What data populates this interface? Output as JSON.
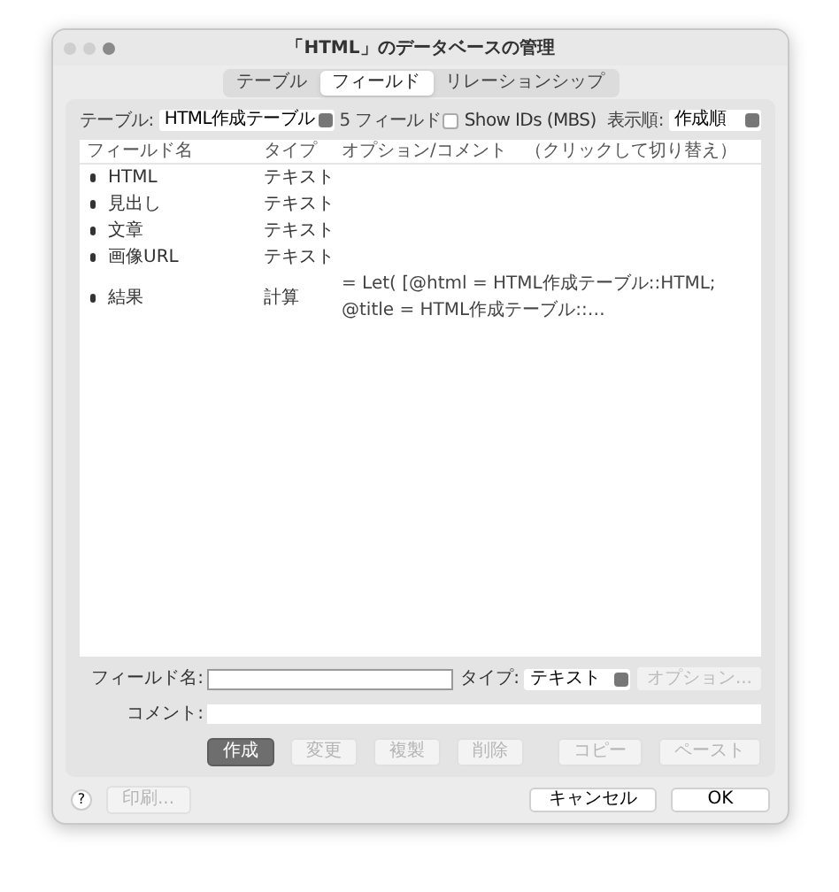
{
  "window": {
    "title": "「HTML」のデータベースの管理"
  },
  "tabs": [
    {
      "label": "テーブル",
      "selected": false
    },
    {
      "label": "フィールド",
      "selected": true
    },
    {
      "label": "リレーションシップ",
      "selected": false
    }
  ],
  "toolbar": {
    "table_label": "テーブル:",
    "table_value": "HTML作成テーブル",
    "field_count": "5 フィールド",
    "show_ids": {
      "label": "Show IDs (MBS)",
      "checked": false
    },
    "order_label": "表示順:",
    "order_value": "作成順"
  },
  "table": {
    "columns": [
      "フィールド名",
      "タイプ",
      "オプション/コメント　（クリックして切り替え）"
    ],
    "rows": [
      {
        "name": "HTML",
        "type": "テキスト",
        "options": ""
      },
      {
        "name": "見出し",
        "type": "テキスト",
        "options": ""
      },
      {
        "name": "文章",
        "type": "テキスト",
        "options": ""
      },
      {
        "name": "画像URL",
        "type": "テキスト",
        "options": ""
      },
      {
        "name": "結果",
        "type": "計算",
        "options": "= Let(  [@html   = HTML作成テーブル::HTML;   @title   = HTML作成テーブル::…"
      }
    ]
  },
  "form": {
    "name_label": "フィールド名:",
    "type_label": "タイプ:",
    "type_value": "テキスト",
    "options_button": {
      "label": "オプション...",
      "disabled": true
    },
    "comment_label": "コメント:"
  },
  "actions": [
    {
      "label": "作成",
      "disabled": false
    },
    {
      "label": "変更",
      "disabled": true
    },
    {
      "label": "複製",
      "disabled": true
    },
    {
      "label": "削除",
      "disabled": true
    }
  ],
  "clipboard": [
    {
      "label": "コピー",
      "disabled": true
    },
    {
      "label": "ペースト",
      "disabled": true
    }
  ],
  "footer": {
    "help": "?",
    "print": {
      "label": "印刷...",
      "disabled": true
    },
    "cancel": "キャンセル",
    "ok": "OK"
  }
}
